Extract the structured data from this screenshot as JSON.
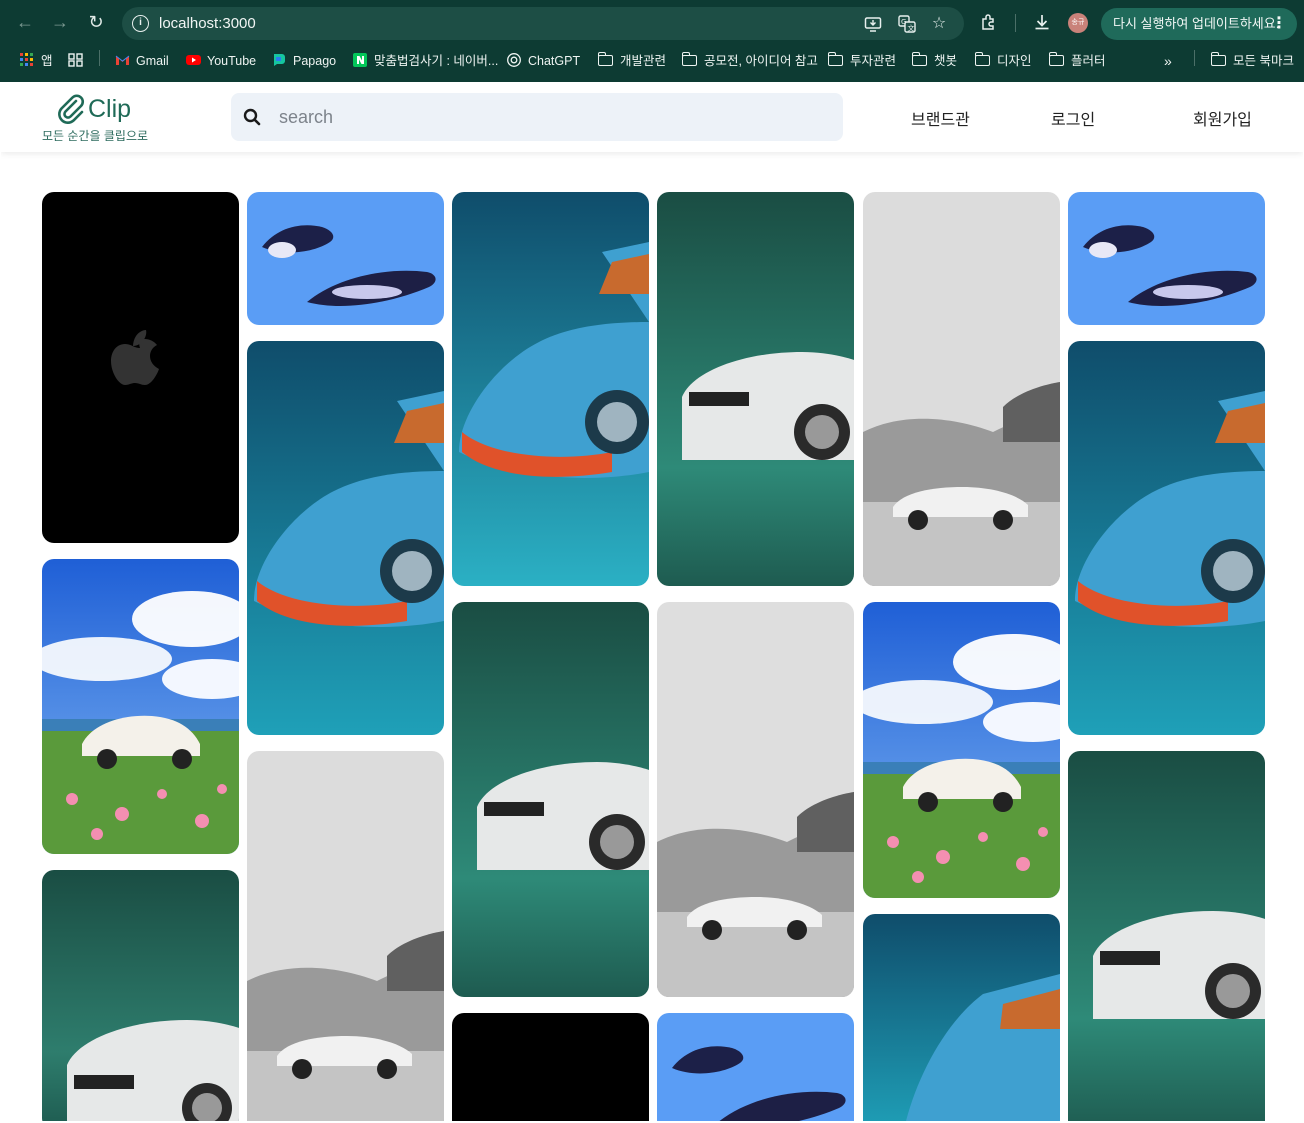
{
  "browser": {
    "url": "localhost:3000",
    "update_label": "다시 실행하여 업데이트하세요.",
    "profile_label": "송규",
    "bookmarks": [
      {
        "label": "앱",
        "icon": "apps-grid-icon"
      },
      {
        "label": "",
        "icon": "tab-groups-icon"
      },
      {
        "label": "Gmail",
        "icon": "gmail-icon"
      },
      {
        "label": "YouTube",
        "icon": "youtube-icon"
      },
      {
        "label": "Papago",
        "icon": "papago-icon"
      },
      {
        "label": "맞춤법검사기 : 네이버...",
        "icon": "naver-icon"
      },
      {
        "label": "ChatGPT",
        "icon": "chatgpt-icon"
      },
      {
        "label": "개발관련",
        "icon": "folder-icon"
      },
      {
        "label": "공모전, 아이디어 참고",
        "icon": "folder-icon"
      },
      {
        "label": "투자관련",
        "icon": "folder-icon"
      },
      {
        "label": "챗봇",
        "icon": "folder-icon"
      },
      {
        "label": "디자인",
        "icon": "folder-icon"
      },
      {
        "label": "플러터",
        "icon": "folder-icon"
      },
      {
        "label": "모든 북마크",
        "icon": "folder-icon"
      }
    ]
  },
  "header": {
    "logo_text": "Clip",
    "tagline": "모든 순간을 클립으로",
    "search_placeholder": "search",
    "nav": [
      "브랜드관",
      "로그인",
      "회원가입"
    ]
  },
  "colors": {
    "brand": "#1f6a57",
    "chrome": "#0d3b33",
    "search_bg": "#edf2f8"
  },
  "gallery": {
    "columns": [
      [
        "black-apple-wallpaper",
        "porsche-flower-field",
        "bmw-white-teal"
      ],
      [
        "penguins-blue",
        "bmw-blue-teal",
        "porsche-grey-hills"
      ],
      [
        "bmw-blue-teal",
        "bmw-white-teal",
        "black-apple-wallpaper"
      ],
      [
        "bmw-white-teal",
        "porsche-grey-hills",
        "penguins-blue"
      ],
      [
        "porsche-grey-hills",
        "porsche-flower-field",
        "bmw-blue-teal"
      ],
      [
        "penguins-blue",
        "bmw-blue-teal",
        "bmw-white-teal"
      ]
    ]
  }
}
